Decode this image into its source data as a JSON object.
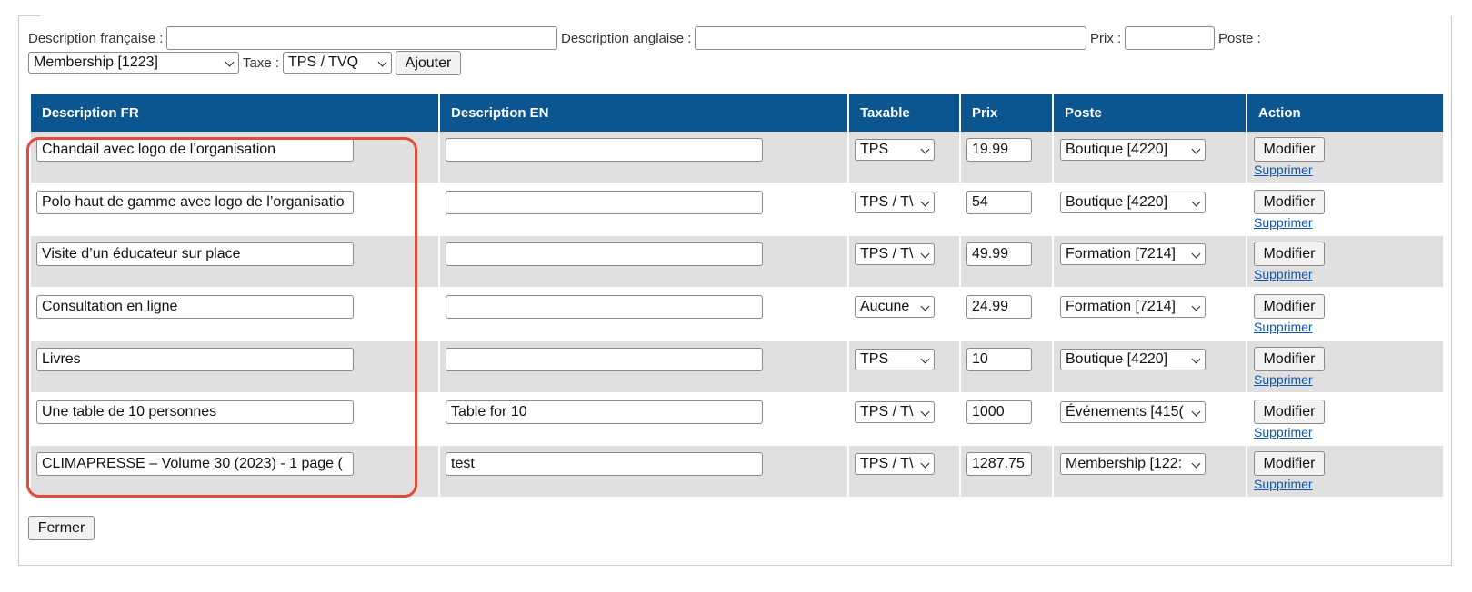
{
  "form": {
    "desc_fr_label": "Description française :",
    "desc_fr_value": "",
    "desc_en_label": "Description anglaise :",
    "desc_en_value": "",
    "price_label": "Prix :",
    "price_value": "",
    "poste_label": "Poste :",
    "poste_selected": "Membership [1223]",
    "tax_label": "Taxe :",
    "tax_selected": "TPS / TVQ",
    "add_button": "Ajouter"
  },
  "table": {
    "headers": [
      "Description FR",
      "Description EN",
      "Taxable",
      "Prix",
      "Poste",
      "Action"
    ],
    "rows": [
      {
        "desc_fr": "Chandail avec logo de l’organisation",
        "desc_en": "",
        "tax": "TPS",
        "price": "19.99",
        "poste": "Boutique [4220]",
        "modify": "Modifier",
        "delete": "Supprimer"
      },
      {
        "desc_fr": "Polo haut de gamme avec logo de l’organisatio",
        "desc_en": "",
        "tax": "TPS / T\\",
        "price": "54",
        "poste": "Boutique [4220]",
        "modify": "Modifier",
        "delete": "Supprimer"
      },
      {
        "desc_fr": "Visite d’un éducateur sur place",
        "desc_en": "",
        "tax": "TPS / T\\",
        "price": "49.99",
        "poste": "Formation [7214]",
        "modify": "Modifier",
        "delete": "Supprimer"
      },
      {
        "desc_fr": "Consultation en ligne",
        "desc_en": "",
        "tax": "Aucune",
        "price": "24.99",
        "poste": "Formation [7214]",
        "modify": "Modifier",
        "delete": "Supprimer"
      },
      {
        "desc_fr": "Livres",
        "desc_en": "",
        "tax": "TPS",
        "price": "10",
        "poste": "Boutique [4220]",
        "modify": "Modifier",
        "delete": "Supprimer"
      },
      {
        "desc_fr": "Une table de 10 personnes",
        "desc_en": "Table for 10",
        "tax": "TPS / T\\",
        "price": "1000",
        "poste": "Événements [415(",
        "modify": "Modifier",
        "delete": "Supprimer"
      },
      {
        "desc_fr": "CLIMAPRESSE – Volume 30 (2023) - 1 page (",
        "desc_en": "test",
        "tax": "TPS / T\\",
        "price": "1287.75",
        "poste": "Membership [122:",
        "modify": "Modifier",
        "delete": "Supprimer"
      }
    ]
  },
  "close_button": "Fermer",
  "colors": {
    "header_bg": "#0b5590",
    "row_alt_bg": "#e0e0e0",
    "highlight": "#e14b3b",
    "link": "#0a57b5"
  }
}
